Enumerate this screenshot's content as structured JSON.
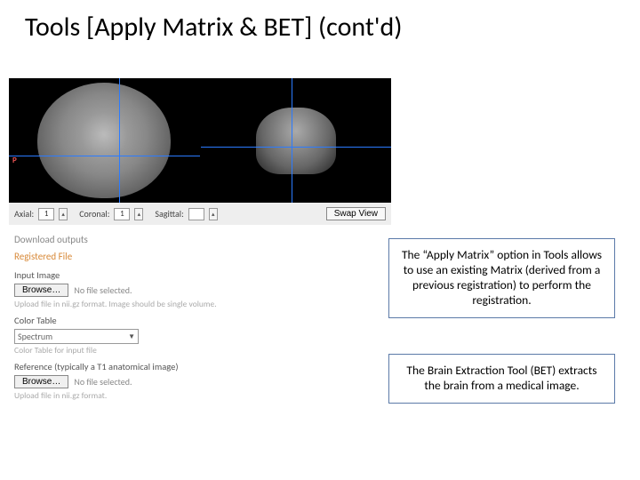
{
  "title": "Tools [Apply Matrix & BET] (cont'd)",
  "controls": {
    "axial_label": "Axial:",
    "axial_value": "1",
    "coronal_label": "Coronal:",
    "coronal_value": "1",
    "sagittal_label": "Sagittal:",
    "sagittal_value": "",
    "swap_label": "Swap View"
  },
  "download": {
    "title": "Download outputs"
  },
  "registered": {
    "title": "Registered File"
  },
  "input": {
    "label": "Input Image",
    "browse": "Browse…",
    "status": "No file selected.",
    "hint": "Upload file in nii.gz format. Image should be single volume."
  },
  "colortable": {
    "label": "Color Table",
    "value": "Spectrum",
    "hint": "Color Table for input file"
  },
  "reference": {
    "label": "Reference (typically a T1 anatomical image)",
    "browse": "Browse…",
    "status": "No file selected.",
    "hint": "Upload file in nii.gz format."
  },
  "callout1": "The “Apply Matrix” option in Tools allows to use an existing Matrix (derived from a previous registration) to perform the registration.",
  "callout2": "The Brain Extraction Tool (BET) extracts the brain from a medical image."
}
